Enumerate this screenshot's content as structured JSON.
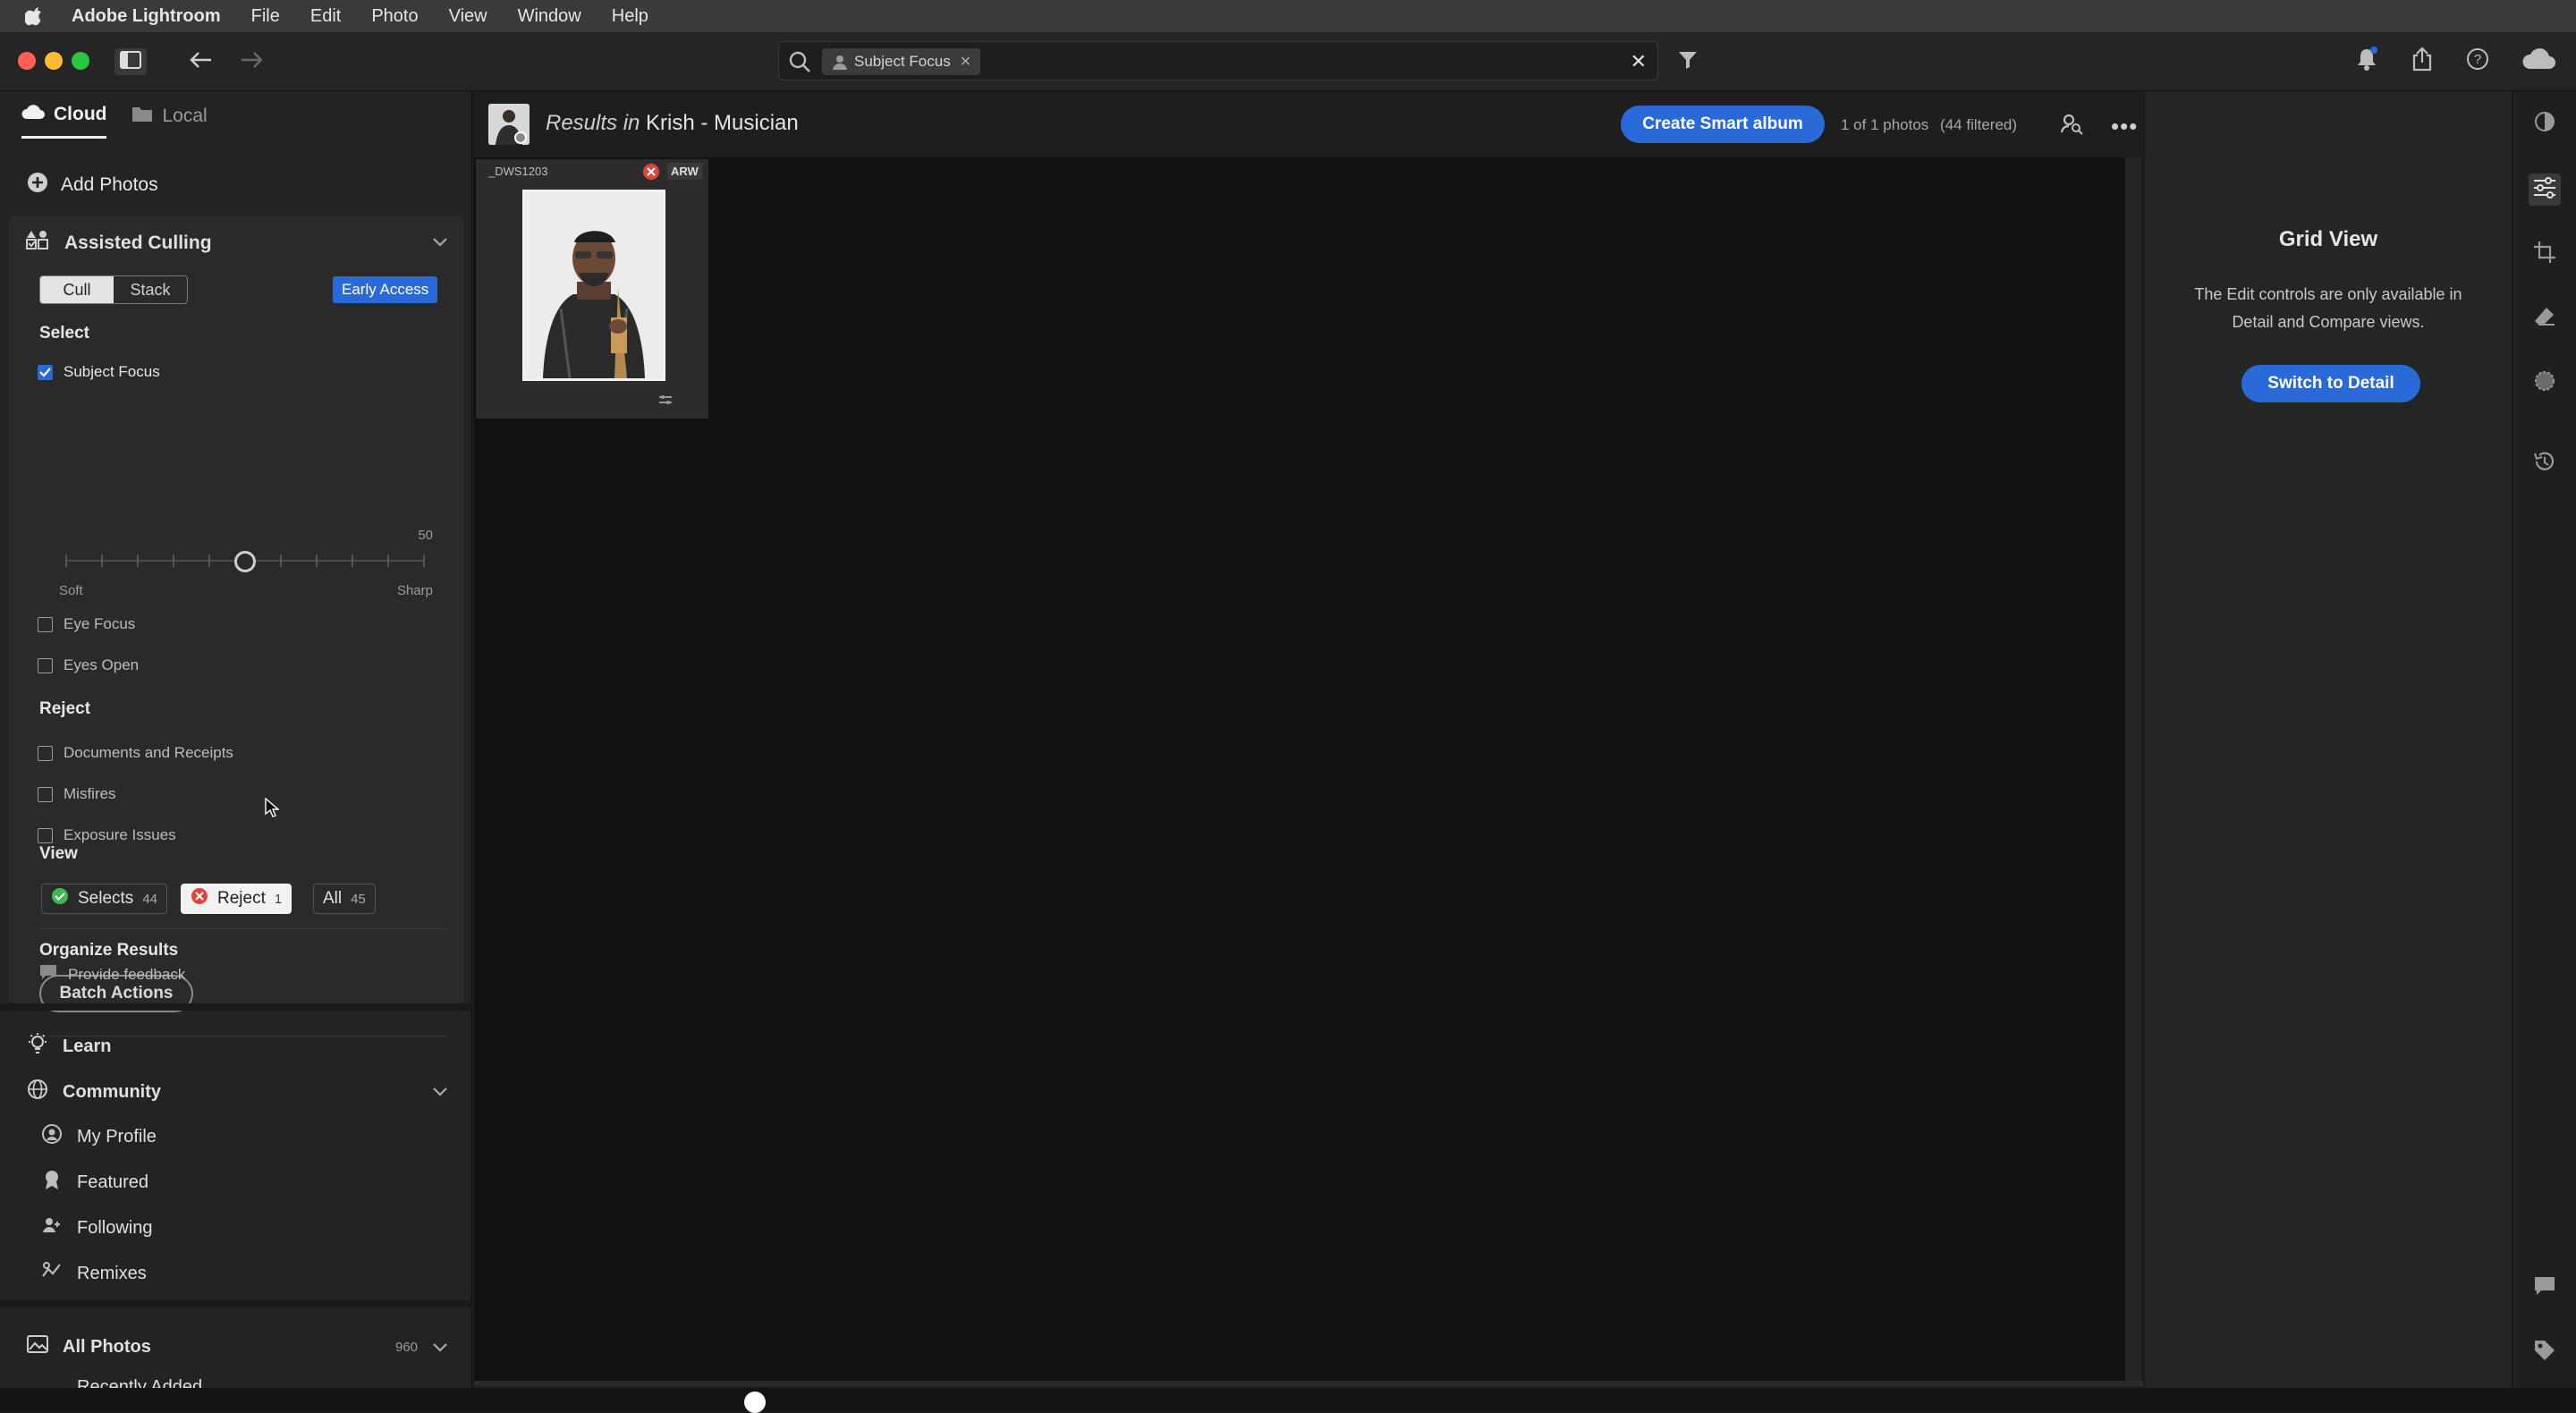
{
  "menubar": {
    "app_name": "Adobe Lightroom",
    "items": [
      "File",
      "Edit",
      "Photo",
      "View",
      "Window",
      "Help"
    ]
  },
  "toolbar": {
    "search_chip": "Subject Focus"
  },
  "left": {
    "tabs": [
      {
        "label": "Cloud",
        "icon": "cloud-icon",
        "active": true
      },
      {
        "label": "Local",
        "icon": "folder-icon",
        "active": false
      }
    ],
    "add_photos": "Add Photos",
    "culling": {
      "title": "Assisted Culling",
      "segments": [
        "Cull",
        "Stack"
      ],
      "badge": "Early Access",
      "select_heading": "Select",
      "subject_focus": "Subject Focus",
      "slider": {
        "value": "50",
        "min_label": "Soft",
        "max_label": "Sharp",
        "level": 0.5
      },
      "eye_focus": "Eye Focus",
      "eyes_open": "Eyes Open",
      "reject_heading": "Reject",
      "documents": "Documents and Receipts",
      "misfires": "Misfires",
      "exposure": "Exposure Issues",
      "view_heading": "View",
      "view_buttons": [
        {
          "label": "Selects",
          "count": "44"
        },
        {
          "label": "Reject",
          "count": "1"
        },
        {
          "label": "All",
          "count": "45"
        }
      ],
      "organize_heading": "Organize Results",
      "batch_actions": "Batch Actions",
      "feedback": "Provide feedback"
    },
    "learn": "Learn",
    "community": "Community",
    "community_items": [
      "My Profile",
      "Featured",
      "Following",
      "Remixes"
    ],
    "all_photos": "All Photos",
    "all_photos_count": "960",
    "recently_added": "Recently Added"
  },
  "center": {
    "results_prefix": "Results in",
    "album_name": "Krish - Musician",
    "create_smart_album": "Create Smart album",
    "photo_count": "1 of 1 photos",
    "filtered": "(44 filtered)",
    "photo": {
      "filename": "_DWS1203",
      "format": "ARW"
    }
  },
  "right": {
    "title": "Grid View",
    "text": "The Edit controls are only available in Detail and Compare views.",
    "button": "Switch to Detail"
  },
  "colors": {
    "accent": "#2a6ad8",
    "reject": "#e0453a",
    "select": "#3fb950"
  }
}
